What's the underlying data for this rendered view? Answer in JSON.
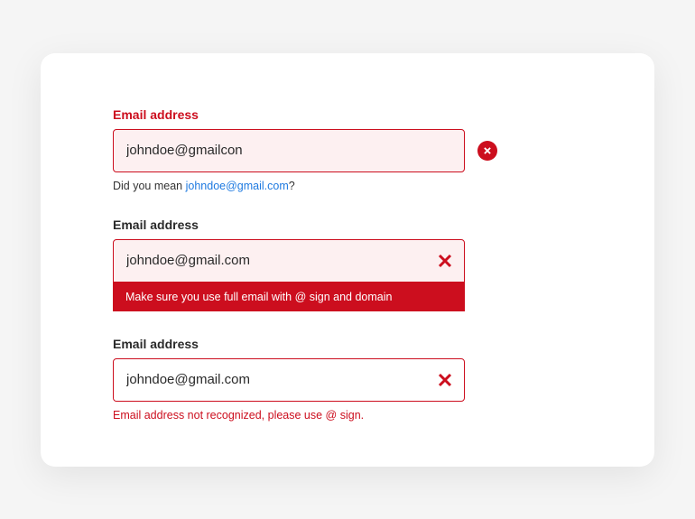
{
  "group1": {
    "label": "Email address",
    "value": "johndoe@gmailcon",
    "suggestion_prefix": "Did you mean ",
    "suggestion_link": "johndoe@gmail.com",
    "suggestion_suffix": "?"
  },
  "group2": {
    "label": "Email address",
    "value": "johndoe@gmail.com",
    "banner": "Make sure you use full email with @ sign and domain"
  },
  "group3": {
    "label": "Email address",
    "value": "johndoe@gmail.com",
    "error_text": "Email address not recognized, please use @ sign."
  }
}
